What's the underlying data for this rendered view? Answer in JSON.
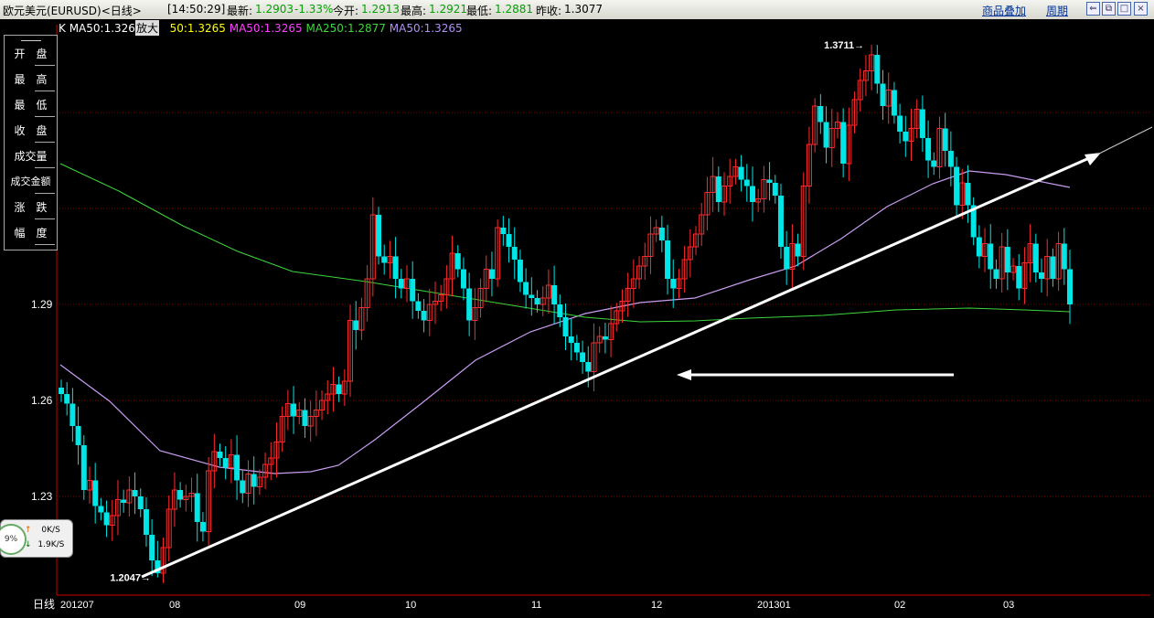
{
  "titlebar": {
    "instrument": "欧元美元(EURUSD)<日线>",
    "time": "[14:50:29]",
    "latest_label": "最新:",
    "latest_value": "1.2903",
    "change": "-1.33%",
    "open_label": "今开:",
    "open_value": "1.2913",
    "high_label": "最高:",
    "high_value": "1.2921",
    "low_label": "最低:",
    "low_value": "1.2881",
    "prev_label": "昨收:",
    "prev_value": "1.3077",
    "overlay_link": "商品叠加",
    "period_link": "周期"
  },
  "colors": {
    "up": "#ff2a2a",
    "down": "#00e5e5",
    "ma_yellow": "#ffff00",
    "ma_magenta": "#ff40ff",
    "ma250": "#3cd63c",
    "ma50_violet": "#c89cf0",
    "grid": "#7a0000",
    "axis": "#cc0000"
  },
  "legend": {
    "k": "K",
    "ma50_first": "MA50:1.326",
    "zoom": "放大",
    "ma_yellow": "50:1.3265",
    "ma_magenta": "MA50:1.3265",
    "ma250": "MA250:1.2877",
    "ma_violet": "MA50:1.3265"
  },
  "fields": [
    "开　盘",
    "最　高",
    "最　低",
    "收　盘",
    "成交量",
    "成交金额",
    "涨　跌",
    "幅　度"
  ],
  "net": {
    "percent": "9%",
    "up": "0K/S",
    "down": "1.9K/S",
    "up_icon": "arrow-up-icon",
    "down_icon": "arrow-down-icon"
  },
  "chart_data": {
    "type": "candlestick",
    "x_axis_label": "日线",
    "x_ticks": [
      "201207",
      "08",
      "09",
      "10",
      "11",
      "12",
      "201301",
      "02",
      "03"
    ],
    "y_ticks": [
      1.23,
      1.26,
      1.29
    ],
    "ylim": [
      1.2,
      1.38
    ],
    "annotations": {
      "max": "1.3711",
      "min": "1.2047"
    },
    "closes": [
      1.262,
      1.259,
      1.252,
      1.246,
      1.232,
      1.235,
      1.227,
      1.225,
      1.221,
      1.224,
      1.229,
      1.228,
      1.232,
      1.23,
      1.226,
      1.218,
      1.21,
      1.206,
      1.214,
      1.226,
      1.232,
      1.229,
      1.23,
      1.231,
      1.222,
      1.219,
      1.238,
      1.244,
      1.242,
      1.239,
      1.243,
      1.235,
      1.231,
      1.237,
      1.233,
      1.236,
      1.24,
      1.242,
      1.247,
      1.255,
      1.259,
      1.255,
      1.257,
      1.252,
      1.255,
      1.257,
      1.26,
      1.262,
      1.265,
      1.262,
      1.266,
      1.285,
      1.282,
      1.289,
      1.298,
      1.318,
      1.305,
      1.303,
      1.305,
      1.298,
      1.295,
      1.298,
      1.291,
      1.288,
      1.285,
      1.29,
      1.291,
      1.293,
      1.298,
      1.306,
      1.301,
      1.295,
      1.285,
      1.289,
      1.295,
      1.301,
      1.298,
      1.314,
      1.312,
      1.308,
      1.304,
      1.297,
      1.293,
      1.292,
      1.29,
      1.292,
      1.296,
      1.29,
      1.286,
      1.28,
      1.278,
      1.275,
      1.272,
      1.269,
      1.278,
      1.28,
      1.279,
      1.284,
      1.288,
      1.291,
      1.295,
      1.298,
      1.302,
      1.305,
      1.312,
      1.314,
      1.31,
      1.298,
      1.295,
      1.298,
      1.304,
      1.308,
      1.312,
      1.318,
      1.325,
      1.33,
      1.322,
      1.327,
      1.33,
      1.333,
      1.329,
      1.327,
      1.322,
      1.323,
      1.329,
      1.328,
      1.324,
      1.308,
      1.301,
      1.309,
      1.305,
      1.327,
      1.34,
      1.352,
      1.347,
      1.339,
      1.345,
      1.347,
      1.334,
      1.346,
      1.354,
      1.36,
      1.363,
      1.368,
      1.359,
      1.352,
      1.357,
      1.349,
      1.344,
      1.341,
      1.345,
      1.351,
      1.342,
      1.335,
      1.333,
      1.345,
      1.338,
      1.333,
      1.321,
      1.328,
      1.321,
      1.311,
      1.305,
      1.309,
      1.301,
      1.298,
      1.308,
      1.3,
      1.302,
      1.295,
      1.303,
      1.309,
      1.3,
      1.298,
      1.305,
      1.298,
      1.309,
      1.301,
      1.29
    ]
  }
}
